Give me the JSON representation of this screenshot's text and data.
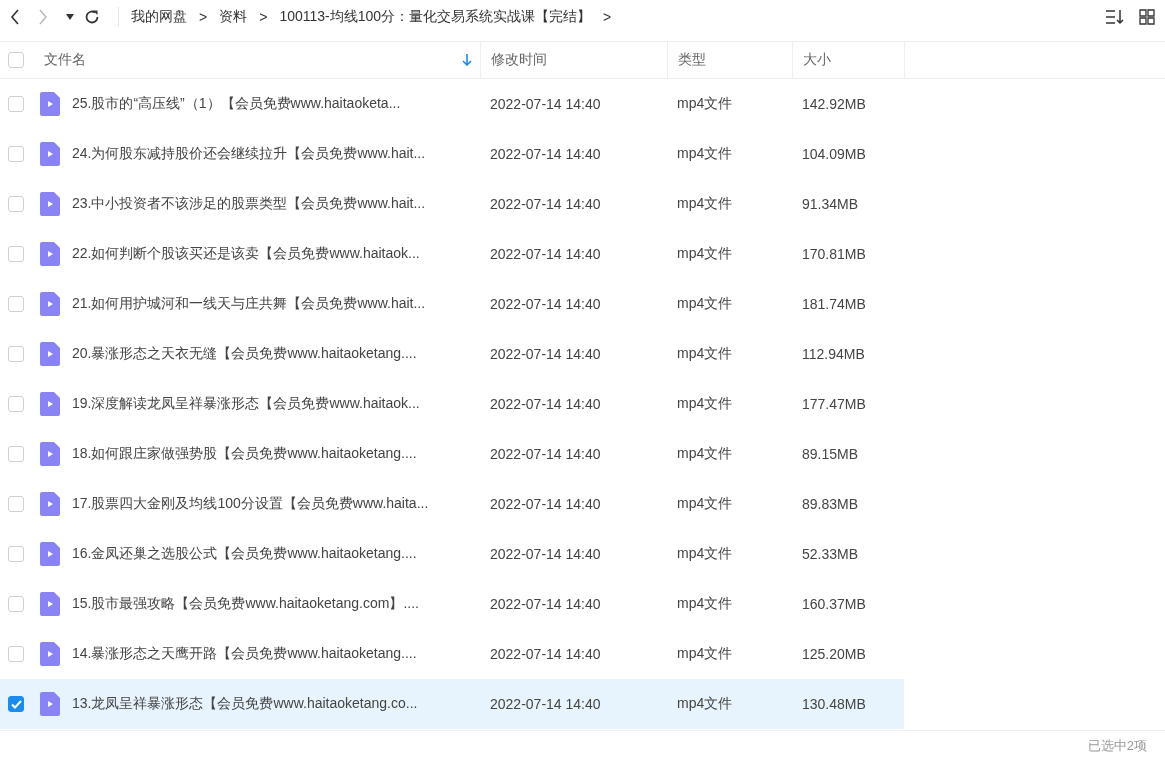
{
  "toolbar": {
    "breadcrumbs": [
      "我的网盘",
      "资料",
      "100113-均线100分：量化交易系统实战课【完结】"
    ],
    "separator": ">"
  },
  "table": {
    "columns": [
      {
        "label": "文件名",
        "sorted": true
      },
      {
        "label": "修改时间",
        "sorted": false
      },
      {
        "label": "类型",
        "sorted": false
      },
      {
        "label": "大小",
        "sorted": false
      }
    ],
    "all_checked": false,
    "rows": [
      {
        "name": "25.股市的“高压线”（1）【会员免费www.haitaoketa...",
        "modified": "2022-07-14 14:40",
        "type": "mp4文件",
        "size": "142.92MB",
        "selected": false
      },
      {
        "name": "24.为何股东减持股价还会继续拉升【会员免费www.hait...",
        "modified": "2022-07-14 14:40",
        "type": "mp4文件",
        "size": "104.09MB",
        "selected": false
      },
      {
        "name": "23.中小投资者不该涉足的股票类型【会员免费www.hait...",
        "modified": "2022-07-14 14:40",
        "type": "mp4文件",
        "size": "91.34MB",
        "selected": false
      },
      {
        "name": "22.如何判断个股该买还是该卖【会员免费www.haitaok...",
        "modified": "2022-07-14 14:40",
        "type": "mp4文件",
        "size": "170.81MB",
        "selected": false
      },
      {
        "name": "21.如何用护城河和一线天与庄共舞【会员免费www.hait...",
        "modified": "2022-07-14 14:40",
        "type": "mp4文件",
        "size": "181.74MB",
        "selected": false
      },
      {
        "name": "20.暴涨形态之天衣无缝【会员免费www.haitaoketang....",
        "modified": "2022-07-14 14:40",
        "type": "mp4文件",
        "size": "112.94MB",
        "selected": false
      },
      {
        "name": "19.深度解读龙凤呈祥暴涨形态【会员免费www.haitaok...",
        "modified": "2022-07-14 14:40",
        "type": "mp4文件",
        "size": "177.47MB",
        "selected": false
      },
      {
        "name": "18.如何跟庄家做强势股【会员免费www.haitaoketang....",
        "modified": "2022-07-14 14:40",
        "type": "mp4文件",
        "size": "89.15MB",
        "selected": false
      },
      {
        "name": "17.股票四大金刚及均线100分设置【会员免费www.haita...",
        "modified": "2022-07-14 14:40",
        "type": "mp4文件",
        "size": "89.83MB",
        "selected": false
      },
      {
        "name": "16.金凤还巢之选股公式【会员免费www.haitaoketang....",
        "modified": "2022-07-14 14:40",
        "type": "mp4文件",
        "size": "52.33MB",
        "selected": false
      },
      {
        "name": "15.股市最强攻略【会员免费www.haitaoketang.com】....",
        "modified": "2022-07-14 14:40",
        "type": "mp4文件",
        "size": "160.37MB",
        "selected": false
      },
      {
        "name": "14.暴涨形态之天鹰开路【会员免费www.haitaoketang....",
        "modified": "2022-07-14 14:40",
        "type": "mp4文件",
        "size": "125.20MB",
        "selected": false
      },
      {
        "name": "13.龙凤呈祥暴涨形态【会员免费www.haitaoketang.co...",
        "modified": "2022-07-14 14:40",
        "type": "mp4文件",
        "size": "130.48MB",
        "selected": true
      }
    ]
  },
  "status_bar": {
    "text": "已选中2项"
  }
}
